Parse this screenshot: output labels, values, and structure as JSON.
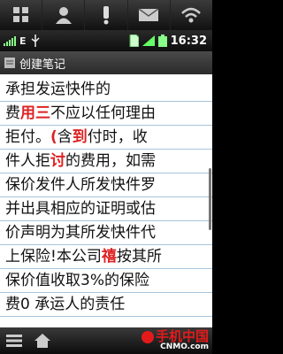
{
  "status": {
    "time": "16:32",
    "signal_label": "E"
  },
  "header": {
    "title": "创建笔记"
  },
  "editor": {
    "lines": [
      {
        "segments": [
          {
            "text": "承担发运快件的",
            "red": false
          }
        ]
      },
      {
        "segments": [
          {
            "text": "费",
            "red": false
          },
          {
            "text": "用三",
            "red": true
          },
          {
            "text": "不应以任何理由",
            "red": false
          }
        ]
      },
      {
        "segments": [
          {
            "text": "拒付。",
            "red": false
          },
          {
            "text": "(",
            "red": true
          },
          {
            "text": "含",
            "red": false
          },
          {
            "text": "到",
            "red": true
          },
          {
            "text": "付时，收",
            "red": false
          }
        ]
      },
      {
        "segments": [
          {
            "text": "件人拒",
            "red": false
          },
          {
            "text": "讨",
            "red": true
          },
          {
            "text": "的费用，如需",
            "red": false
          }
        ]
      },
      {
        "segments": [
          {
            "text": "保价发件人所发快件罗",
            "red": false
          }
        ]
      },
      {
        "segments": [
          {
            "text": "并出具相应的证明或估",
            "red": false
          }
        ]
      },
      {
        "segments": [
          {
            "text": "价声明为其所发快件代",
            "red": false
          }
        ]
      },
      {
        "segments": [
          {
            "text": "上保险!本公司",
            "red": false
          },
          {
            "text": "禧",
            "red": true
          },
          {
            "text": "按其所",
            "red": false
          }
        ]
      },
      {
        "segments": [
          {
            "text": "保价值收取3%的保险",
            "red": false
          }
        ]
      },
      {
        "segments": [
          {
            "text": "费0 承运人的责任",
            "red": false
          }
        ]
      }
    ]
  },
  "brand": {
    "name": "手机中国",
    "site": "CNMO.com"
  },
  "colors": {
    "accent_red": "#d22222",
    "rule_blue": "#a8c4dc"
  }
}
